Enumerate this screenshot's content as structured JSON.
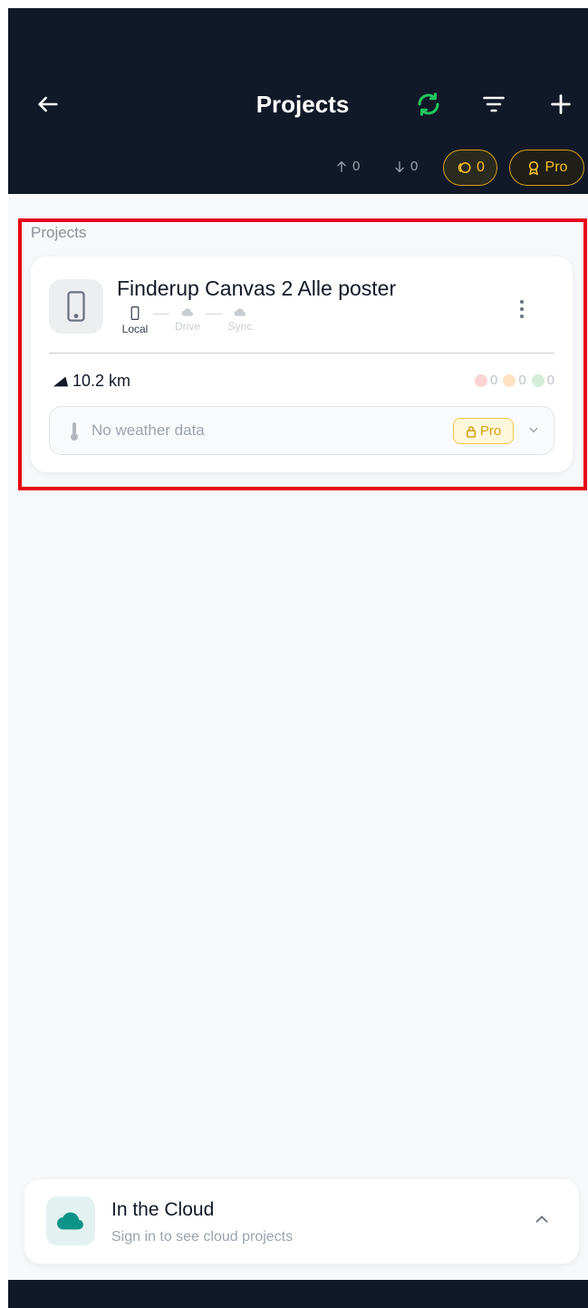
{
  "header": {
    "title": "Projects",
    "upload_count": "0",
    "download_count": "0",
    "points_badge": "0",
    "pro_label": "Pro"
  },
  "icons": {
    "back": "arrow-left-icon",
    "sync": "sync-icon",
    "filter": "filter-icon",
    "add": "plus-icon",
    "upload": "arrow-up-icon",
    "download": "arrow-down-icon",
    "points": "coins-icon",
    "pro": "badge-icon",
    "device": "smartphone-icon",
    "distance": "route-icon",
    "weather": "thermometer-icon",
    "cloud": "cloud-icon"
  },
  "section": {
    "label": "Projects"
  },
  "project": {
    "name": "Finderup Canvas 2 Alle poster",
    "storage": {
      "local": "Local",
      "drive": "Drive",
      "sync": "Sync"
    },
    "distance": "10.2 km",
    "counters": {
      "red": "0",
      "orange": "0",
      "green": "0"
    },
    "weather": "No weather data",
    "pro_label": "Pro"
  },
  "cloud": {
    "title": "In the Cloud",
    "subtitle": "Sign in to see cloud projects"
  },
  "colors": {
    "header_bg": "#111827",
    "sync_green": "#22c55e",
    "pro_gold": "#d4a017",
    "highlight_red": "#e60012",
    "cloud_teal": "#0d9488"
  }
}
